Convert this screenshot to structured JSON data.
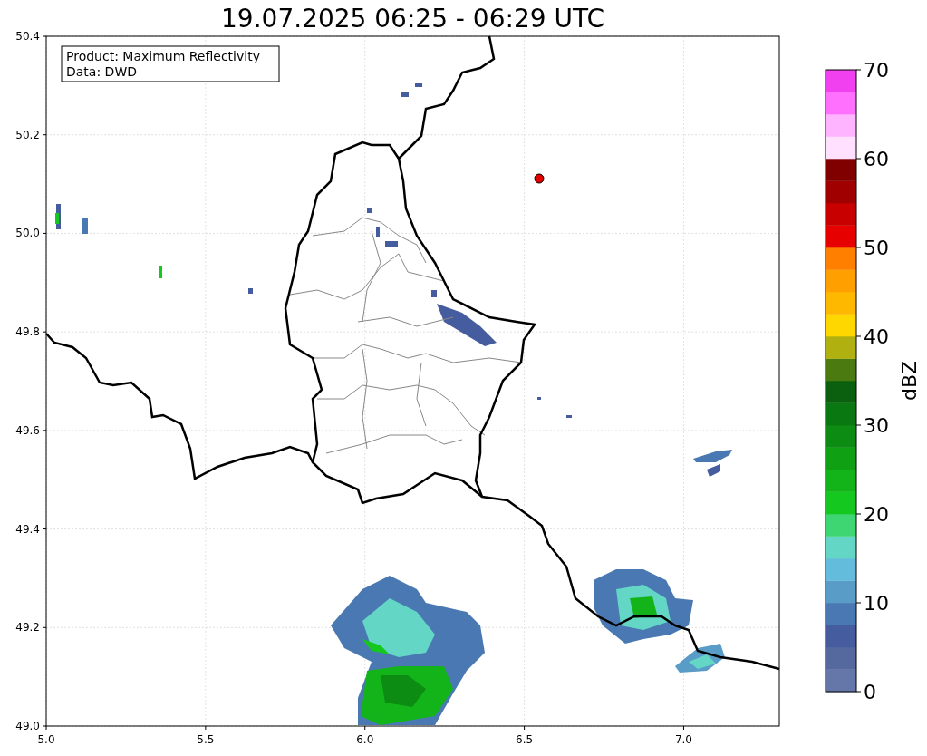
{
  "title": "19.07.2025 06:25 - 06:29 UTC",
  "info_box": [
    "Product: Maximum Reflectivity",
    "Data: DWD"
  ],
  "x_ticks": [
    "5.0",
    "5.5",
    "6.0",
    "6.5",
    "7.0"
  ],
  "y_ticks": [
    "50.4",
    "50.2",
    "50.0",
    "49.8",
    "49.6",
    "49.4",
    "49.2",
    "49.0"
  ],
  "colorbar": {
    "label": "dBZ",
    "ticks": [
      "70",
      "60",
      "50",
      "40",
      "30",
      "20",
      "10",
      "0"
    ],
    "segments": [
      {
        "color": "#6577a8"
      },
      {
        "color": "#56699e"
      },
      {
        "color": "#455c9e"
      },
      {
        "color": "#4a78b2"
      },
      {
        "color": "#5a9cc8"
      },
      {
        "color": "#63bcdc"
      },
      {
        "color": "#63d6c6"
      },
      {
        "color": "#3ed672"
      },
      {
        "color": "#14c820"
      },
      {
        "color": "#12b41a"
      },
      {
        "color": "#10a014"
      },
      {
        "color": "#0c8c12"
      },
      {
        "color": "#0a7810"
      },
      {
        "color": "#0a600e"
      },
      {
        "color": "#4a7a10"
      },
      {
        "color": "#b0b010"
      },
      {
        "color": "#ffd700"
      },
      {
        "color": "#ffb800"
      },
      {
        "color": "#ff9f00"
      },
      {
        "color": "#ff7f00"
      },
      {
        "color": "#e60000"
      },
      {
        "color": "#c80000"
      },
      {
        "color": "#a00000"
      },
      {
        "color": "#800000"
      },
      {
        "color": "#ffe0ff"
      },
      {
        "color": "#ffb4ff"
      },
      {
        "color": "#ff70ff"
      },
      {
        "color": "#f040f0"
      }
    ]
  }
}
